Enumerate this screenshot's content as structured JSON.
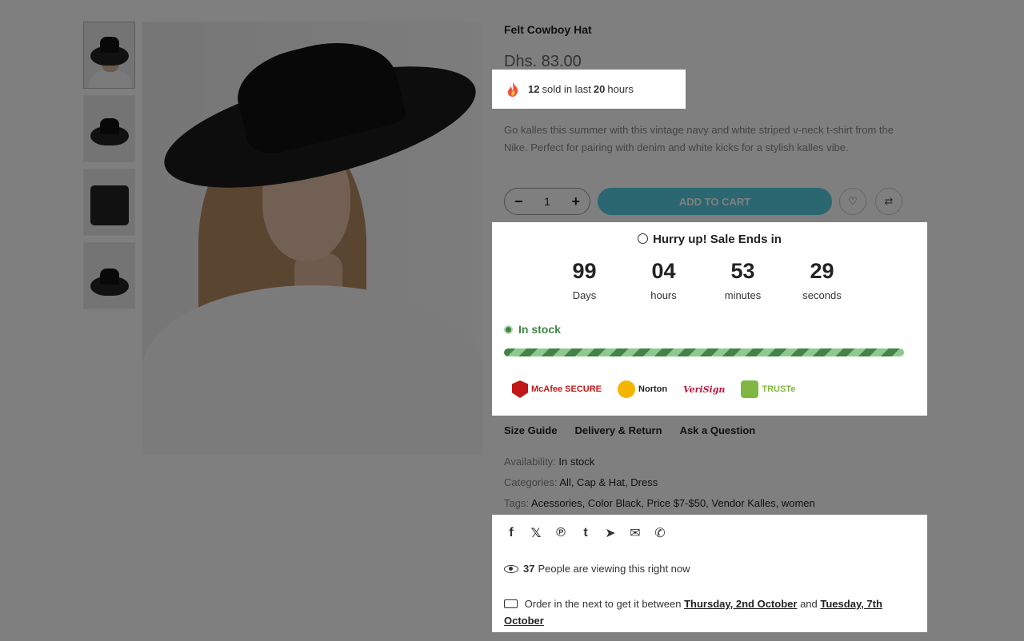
{
  "product": {
    "title": "Felt Cowboy Hat",
    "price": "Dhs. 83.00",
    "sold_count": "12",
    "sold_text_1": "sold in last",
    "sold_hours": "20",
    "sold_text_2": "hours",
    "description": "Go kalles this summer with this vintage navy and white striped v-neck t-shirt from the Nike. Perfect for pairing with denim and white kicks for a stylish kalles vibe.",
    "quantity": "1",
    "add_to_cart": "ADD TO CART"
  },
  "countdown": {
    "heading": "Hurry up! Sale Ends in",
    "units": [
      {
        "value": "99",
        "label": "Days"
      },
      {
        "value": "04",
        "label": "hours"
      },
      {
        "value": "53",
        "label": "minutes"
      },
      {
        "value": "29",
        "label": "seconds"
      }
    ],
    "stock_text": "In stock"
  },
  "badges": [
    "McAfee SECURE",
    "Norton",
    "VeriSign",
    "TRUSTe"
  ],
  "tabs": [
    "Size Guide",
    "Delivery & Return",
    "Ask a Question"
  ],
  "meta": {
    "availability_label": "Availability:",
    "availability_value": "In stock",
    "categories_label": "Categories:",
    "categories": "All, Cap & Hat, Dress",
    "tags_label": "Tags:",
    "tags": "Acessories, Color Black, Price $7-$50, Vendor Kalles, women"
  },
  "social": {
    "viewers": "37",
    "viewing_text": "People are viewing this right now",
    "order_prefix": "Order in the next to get it between",
    "date_from": "Thursday, 2nd October",
    "and": "and",
    "date_to": "Tuesday, 7th October"
  },
  "colors": {
    "accent": "#56cfe1",
    "stock": "#428445"
  }
}
